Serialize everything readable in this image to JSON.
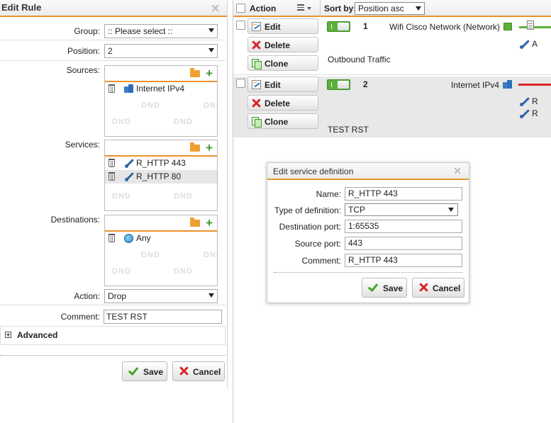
{
  "edit_rule": {
    "title": "Edit Rule",
    "close_glyph": "✕",
    "fields": {
      "group_label": "Group:",
      "group_value": ":: Please select ::",
      "position_label": "Position:",
      "position_value": "2",
      "sources_label": "Sources:",
      "services_label": "Services:",
      "destinations_label": "Destinations:",
      "action_label": "Action:",
      "action_value": "Drop",
      "comment_label": "Comment:",
      "comment_value": "TEST RST"
    },
    "sources": [
      "Internet IPv4"
    ],
    "services": [
      "R_HTTP 443",
      "R_HTTP 80"
    ],
    "destinations": [
      "Any"
    ],
    "dnd_text": "DND",
    "advanced_label": "Advanced",
    "save_label": "Save",
    "cancel_label": "Cancel"
  },
  "rule_list": {
    "header": {
      "action_label": "Action",
      "sort_by_label": "Sort by:",
      "sort_value": "Position asc"
    },
    "buttons": {
      "edit": "Edit",
      "delete": "Delete",
      "clone": "Clone"
    },
    "rules": [
      {
        "number": "1",
        "network": "Wifi Cisco Network (Network)",
        "comment": "Outbound Traffic",
        "truncated_letters": [
          "A"
        ]
      },
      {
        "number": "2",
        "network": "Internet IPv4",
        "comment": "TEST RST",
        "truncated_letters": [
          "R",
          "R"
        ]
      }
    ]
  },
  "service_dialog": {
    "title": "Edit service definition",
    "close_glyph": "✕",
    "name_label": "Name:",
    "name_value": "R_HTTP 443",
    "type_label": "Type of definition:",
    "type_value": "TCP",
    "dest_port_label": "Destination port:",
    "dest_port_value": "1:65535",
    "src_port_label": "Source port:",
    "src_port_value": "443",
    "comment_label": "Comment:",
    "comment_value": "R_HTTP 443",
    "save_label": "Save",
    "cancel_label": "Cancel"
  },
  "colors": {
    "accent_orange": "#e8922a",
    "toggle_green": "#5cb03a",
    "delete_red": "#d6262a",
    "icon_blue": "#2f64a8",
    "row_highlight": "#e8e8e8"
  }
}
